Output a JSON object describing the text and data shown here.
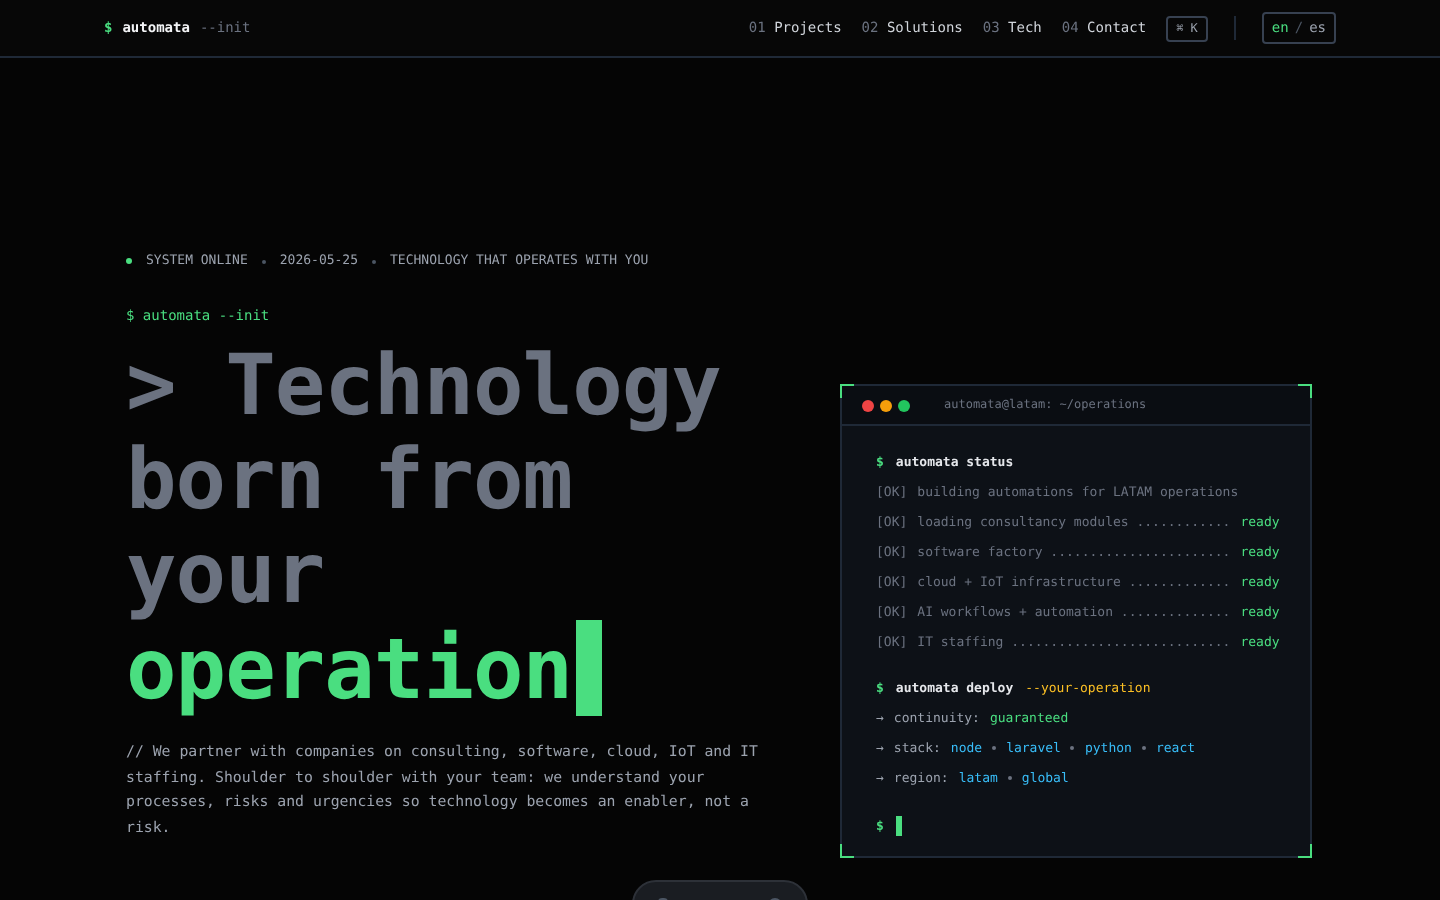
{
  "nav": {
    "brand": {
      "prompt": "$",
      "name": "automata",
      "arg": "--init"
    },
    "links": [
      {
        "number": "01",
        "label": "Projects"
      },
      {
        "number": "02",
        "label": "Solutions"
      },
      {
        "number": "03",
        "label": "Tech"
      },
      {
        "number": "04",
        "label": "Contact"
      }
    ],
    "shortcut": "⌘ K",
    "language": {
      "separator": "/",
      "options": [
        {
          "label": "en",
          "selected": true
        },
        {
          "label": "es",
          "selected": false
        }
      ]
    }
  },
  "hero": {
    "status": [
      "SYSTEM ONLINE",
      "2026-05-25",
      "TECHNOLOGY THAT OPERATES WITH YOU"
    ],
    "command": "$ automata --init",
    "headline": [
      "> Technology",
      "born from",
      "your"
    ],
    "highlight": "operation",
    "description": "// We partner with companies on consulting, software, cloud, IoT and IT staffing. Shoulder to shoulder with your team: we understand your processes, risks and urgencies so technology becomes an enabler, not a risk."
  },
  "terminal": {
    "title": "automata@latam: ~/operations",
    "lines": [
      {
        "kind": "command",
        "prompt": "$",
        "text": "automata status"
      },
      {
        "kind": "ok",
        "tag": "[OK]",
        "text": "building automations for LATAM operations"
      },
      {
        "kind": "ok",
        "tag": "[OK]",
        "text": "loading consultancy modules ............",
        "status": "ready"
      },
      {
        "kind": "ok",
        "tag": "[OK]",
        "text": "software factory .......................",
        "status": "ready"
      },
      {
        "kind": "ok",
        "tag": "[OK]",
        "text": "cloud + IoT infrastructure .............",
        "status": "ready"
      },
      {
        "kind": "ok",
        "tag": "[OK]",
        "text": "AI workflows + automation ..............",
        "status": "ready"
      },
      {
        "kind": "ok",
        "tag": "[OK]",
        "text": "IT staffing ............................",
        "status": "ready"
      },
      {
        "kind": "command",
        "prompt": "$",
        "text": "automata deploy",
        "arg": "--your-operation"
      },
      {
        "kind": "output",
        "arrow": "→",
        "key": "continuity:",
        "color": "#4ade80",
        "values": [
          "guaranteed"
        ]
      },
      {
        "kind": "output",
        "arrow": "→",
        "key": "stack:",
        "color": "#38bdf8",
        "values": [
          "node",
          "laravel",
          "python",
          "react"
        ]
      },
      {
        "kind": "output",
        "arrow": "→",
        "key": "region:",
        "color": "#38bdf8",
        "values": [
          "latam",
          "global"
        ]
      },
      {
        "kind": "cursor",
        "prompt": "$"
      }
    ]
  }
}
